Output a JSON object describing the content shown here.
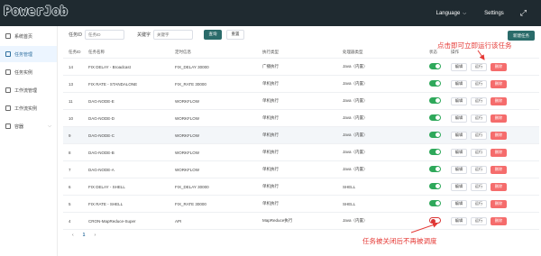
{
  "topbar": {
    "logo": "PowerJob",
    "language": "Language",
    "settings": "Settings",
    "expand_icon": "fullscreen-icon"
  },
  "sidebar": {
    "items": [
      {
        "label": "系统首页",
        "icon": "home-icon",
        "active": false
      },
      {
        "label": "任务管理",
        "icon": "task-icon",
        "active": true
      },
      {
        "label": "任务实例",
        "icon": "instance-icon",
        "active": false
      },
      {
        "label": "工作流管理",
        "icon": "workflow-icon",
        "active": false
      },
      {
        "label": "工作流实例",
        "icon": "workflow-instance-icon",
        "active": false
      },
      {
        "label": "容器",
        "icon": "container-icon",
        "active": false
      }
    ]
  },
  "filter": {
    "id_label": "任务ID",
    "id_placeholder": "任务ID",
    "keyword_label": "关键字",
    "keyword_placeholder": "关键字",
    "query_label": "查询",
    "reset_label": "重置",
    "new_label": "新建任务"
  },
  "table": {
    "headers": [
      "任务ID",
      "任务名称",
      "定时信息",
      "执行类型",
      "处理器类型",
      "状态",
      "操作"
    ],
    "actions": {
      "edit": "编辑",
      "run": "运行",
      "delete": "删除"
    },
    "rows": [
      {
        "id": "14",
        "name": "FIX DELAY - Broadcast",
        "schedule": "FIX_DELAY 30000",
        "exec": "广播执行",
        "processor": "Java（内置）",
        "enabled": true
      },
      {
        "id": "13",
        "name": "FIX RATE - STANDALONE",
        "schedule": "FIX_RATE 30000",
        "exec": "单机执行",
        "processor": "Java（内置）",
        "enabled": true
      },
      {
        "id": "11",
        "name": "DAG-NODE-E",
        "schedule": "WORKFLOW",
        "exec": "单机执行",
        "processor": "Java（内置）",
        "enabled": true
      },
      {
        "id": "10",
        "name": "DAG-NODE-D",
        "schedule": "WORKFLOW",
        "exec": "单机执行",
        "processor": "Java（内置）",
        "enabled": true
      },
      {
        "id": "9",
        "name": "DAG-NODE-C",
        "schedule": "WORKFLOW",
        "exec": "单机执行",
        "processor": "Java（内置）",
        "enabled": true
      },
      {
        "id": "8",
        "name": "DAG-NODE-B",
        "schedule": "WORKFLOW",
        "exec": "单机执行",
        "processor": "Java（内置）",
        "enabled": true
      },
      {
        "id": "7",
        "name": "DAG-NODE-A",
        "schedule": "WORKFLOW",
        "exec": "单机执行",
        "processor": "Java（内置）",
        "enabled": true
      },
      {
        "id": "6",
        "name": "FIX DELAY - SHELL",
        "schedule": "FIX_DELAY 30000",
        "exec": "单机执行",
        "processor": "SHELL",
        "enabled": true
      },
      {
        "id": "5",
        "name": "FIX RATE - SHELL",
        "schedule": "FIX_RATE 30000",
        "exec": "单机执行",
        "processor": "SHELL",
        "enabled": true
      },
      {
        "id": "4",
        "name": "CRON-MapReduce-Super",
        "schedule": "API",
        "exec": "MapReduce执行",
        "processor": "Java（内置）",
        "enabled": false
      }
    ]
  },
  "pager": {
    "prev": "‹",
    "page": "1",
    "next": "›"
  },
  "annotations": {
    "run_hint": "点击即可立即运行该任务",
    "off_hint": "任务被关闭后不再被调度"
  },
  "colors": {
    "topbar": "#1f2a30",
    "primary": "#2a6b6a",
    "switch_on": "#2ea85a",
    "danger": "#f56c6c",
    "annotation": "#e53935"
  }
}
